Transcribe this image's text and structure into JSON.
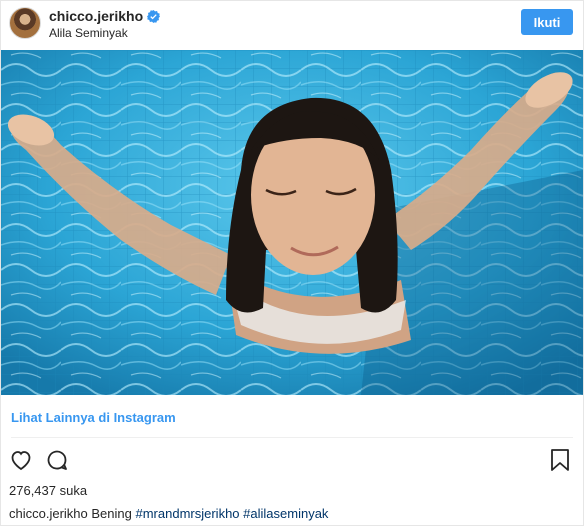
{
  "header": {
    "username": "chicco.jerikho",
    "location": "Alila Seminyak",
    "follow_label": "Ikuti",
    "verified_icon": "verified-badge-icon"
  },
  "post": {
    "more_link": "Lihat Lainnya di Instagram",
    "likes": "276,437 suka",
    "caption": {
      "username": "chicco.jerikho",
      "text": "Bening",
      "hashtags": [
        "#mrandmrsjerikho",
        "#alilaseminyak"
      ]
    }
  },
  "icons": {
    "like": "heart-icon",
    "comment": "comment-icon",
    "save": "bookmark-icon"
  },
  "colors": {
    "accent": "#3897f0",
    "hashtag": "#003569",
    "water": "#2aa6d6"
  }
}
